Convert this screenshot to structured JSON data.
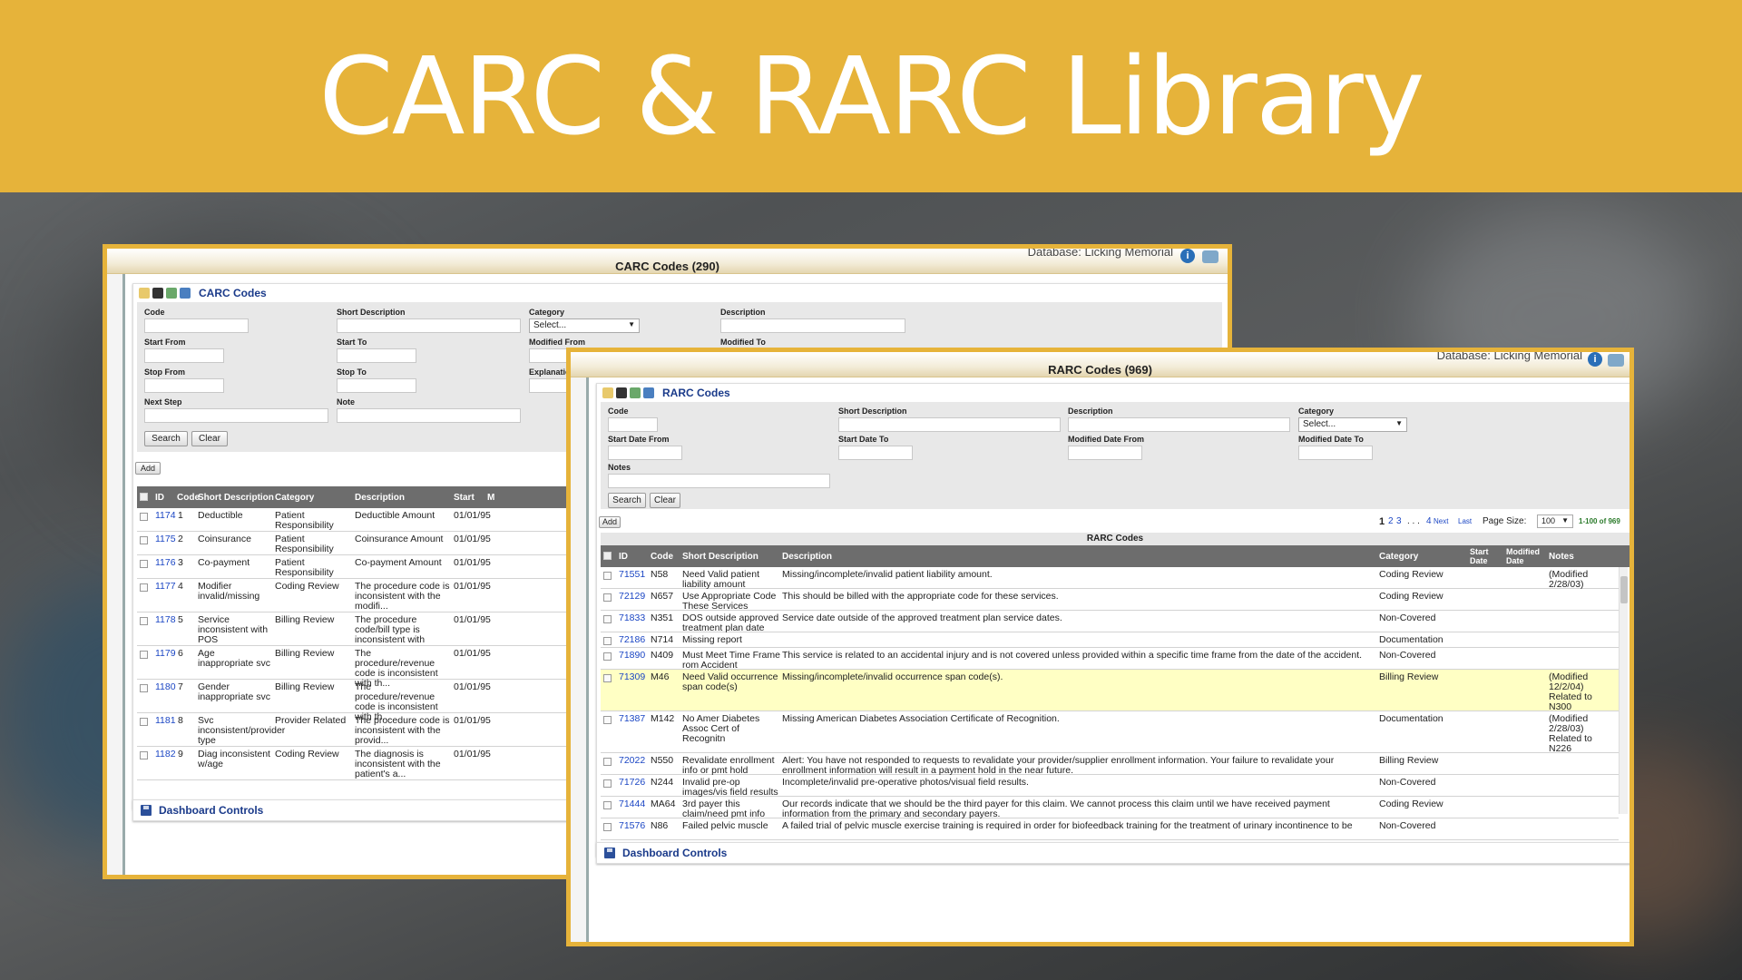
{
  "banner": {
    "title": "CARC & RARC Library"
  },
  "carc": {
    "window_title": "CARC Codes (290)",
    "database": "Database: Licking Memorial",
    "panel_title": "CARC Codes",
    "filters": {
      "code": "Code",
      "short_description": "Short Description",
      "category": "Category",
      "description": "Description",
      "start_from": "Start From",
      "start_to": "Start To",
      "modified_from": "Modified From",
      "modified_to": "Modified To",
      "stop_from": "Stop From",
      "stop_to": "Stop To",
      "explanation": "Explanatio",
      "next_step": "Next Step",
      "note": "Note",
      "category_select": "Select..."
    },
    "buttons": {
      "search": "Search",
      "clear": "Clear",
      "add": "Add"
    },
    "columns": [
      "ID",
      "Code",
      "Short Description",
      "Category",
      "Description",
      "Start",
      "M"
    ],
    "rows": [
      {
        "id": "1174",
        "code": "1",
        "short": "Deductible",
        "category": "Patient Responsibility",
        "desc": "Deductible Amount",
        "start": "01/01/95"
      },
      {
        "id": "1175",
        "code": "2",
        "short": "Coinsurance",
        "category": "Patient Responsibility",
        "desc": "Coinsurance Amount",
        "start": "01/01/95"
      },
      {
        "id": "1176",
        "code": "3",
        "short": "Co-payment",
        "category": "Patient Responsibility",
        "desc": "Co-payment Amount",
        "start": "01/01/95"
      },
      {
        "id": "1177",
        "code": "4",
        "short": "Modifier invalid/missing",
        "category": "Coding Review",
        "desc": "The procedure code is inconsistent with the modifi...",
        "start": "01/01/95"
      },
      {
        "id": "1178",
        "code": "5",
        "short": "Service inconsistent with POS",
        "category": "Billing Review",
        "desc": "The procedure code/bill type is inconsistent with",
        "start": "01/01/95"
      },
      {
        "id": "1179",
        "code": "6",
        "short": "Age inappropriate svc",
        "category": "Billing Review",
        "desc": "The procedure/revenue code is inconsistent with th...",
        "start": "01/01/95"
      },
      {
        "id": "1180",
        "code": "7",
        "short": "Gender inappropriate svc",
        "category": "Billing Review",
        "desc": "The procedure/revenue code is inconsistent with th...",
        "start": "01/01/95"
      },
      {
        "id": "1181",
        "code": "8",
        "short": "Svc inconsistent/provider type",
        "category": "Provider Related",
        "desc": "The procedure code is inconsistent with the provid...",
        "start": "01/01/95"
      },
      {
        "id": "1182",
        "code": "9",
        "short": "Diag inconsistent w/age",
        "category": "Coding Review",
        "desc": "The diagnosis is inconsistent with the patient's a...",
        "start": "01/01/95"
      }
    ],
    "dashboard": "Dashboard Controls"
  },
  "rarc": {
    "window_title": "RARC Codes (969)",
    "database": "Database: Licking Memorial",
    "panel_title": "RARC Codes",
    "filters": {
      "code": "Code",
      "short_description": "Short Description",
      "description": "Description",
      "category": "Category",
      "start_date_from": "Start Date From",
      "start_date_to": "Start Date To",
      "modified_date_from": "Modified Date From",
      "modified_date_to": "Modified Date To",
      "notes": "Notes",
      "category_select": "Select..."
    },
    "buttons": {
      "search": "Search",
      "clear": "Clear",
      "add": "Add"
    },
    "pager": {
      "current": "1",
      "pages": [
        "2",
        "3"
      ],
      "dots": ". . .",
      "last_page": "4",
      "next": "Next",
      "last": "Last",
      "page_size_label": "Page Size:",
      "page_size": "100",
      "range": "1-100 of 969"
    },
    "table_caption": "RARC Codes",
    "columns": {
      "id": "ID",
      "code": "Code",
      "short": "Short Description",
      "desc": "Description",
      "category": "Category",
      "start_date": "Start Date",
      "modified_date": "Modified Date",
      "notes": "Notes"
    },
    "rows": [
      {
        "id": "71551",
        "code": "N58",
        "short": "Need Valid patient liability amount",
        "desc": "Missing/incomplete/invalid patient liability amount.",
        "category": "Coding Review",
        "notes": "(Modified 2/28/03)"
      },
      {
        "id": "72129",
        "code": "N657",
        "short": "Use Appropriate Code These Services",
        "desc": "This should be billed with the appropriate code for these services.",
        "category": "Coding Review",
        "notes": ""
      },
      {
        "id": "71833",
        "code": "N351",
        "short": "DOS outside approved treatment plan date",
        "desc": "Service date outside of the approved treatment plan service dates.",
        "category": "Non-Covered",
        "notes": ""
      },
      {
        "id": "72186",
        "code": "N714",
        "short": "Missing report",
        "desc": "",
        "category": "Documentation",
        "notes": ""
      },
      {
        "id": "71890",
        "code": "N409",
        "short": "Must Meet Time Frame rom Accident",
        "desc": "This service is related to an accidental injury and is not covered unless provided within a specific time frame from the date of the accident.",
        "category": "Non-Covered",
        "notes": ""
      },
      {
        "id": "71309",
        "code": "M46",
        "short": "Need Valid occurrence span code(s)",
        "desc": "Missing/incomplete/invalid occurrence span code(s).",
        "category": "Billing Review",
        "notes": "(Modified 12/2/04) Related to N300"
      },
      {
        "id": "71387",
        "code": "M142",
        "short": "No Amer Diabetes Assoc Cert of Recognitn",
        "desc": "Missing American Diabetes Association Certificate of Recognition.",
        "category": "Documentation",
        "notes": "(Modified 2/28/03) Related to N226"
      },
      {
        "id": "72022",
        "code": "N550",
        "short": "Revalidate enrollment info or pmt hold",
        "desc": "Alert: You have not responded to requests to revalidate your provider/supplier enrollment information. Your failure to revalidate your enrollment information will result in a payment hold in the near future.",
        "category": "Billing Review",
        "notes": ""
      },
      {
        "id": "71726",
        "code": "N244",
        "short": "Invalid pre-op images/vis field results",
        "desc": "Incomplete/invalid pre-operative photos/visual field results.",
        "category": "Non-Covered",
        "notes": ""
      },
      {
        "id": "71444",
        "code": "MA64",
        "short": "3rd payer this claim/need pmt info",
        "desc": "Our records indicate that we should be the third payer for this claim. We cannot process this claim until we have received payment information from the primary and secondary payers.",
        "category": "Coding Review",
        "notes": ""
      },
      {
        "id": "71576",
        "code": "N86",
        "short": "Failed pelvic muscle",
        "desc": "A failed trial of pelvic muscle exercise training is required in order for biofeedback training for the treatment of urinary incontinence to be",
        "category": "Non-Covered",
        "notes": ""
      }
    ],
    "dashboard": "Dashboard Controls"
  }
}
